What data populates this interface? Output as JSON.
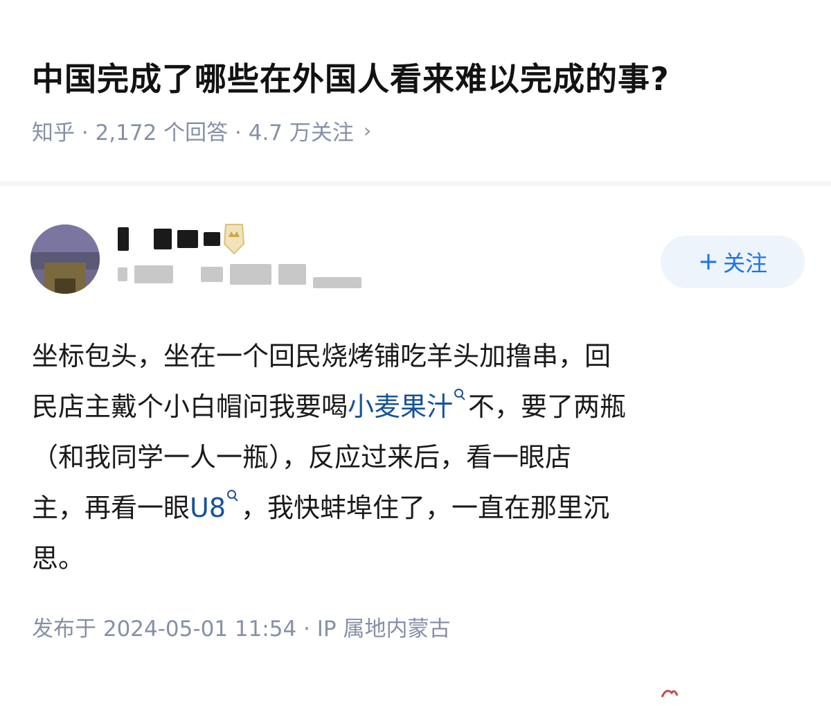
{
  "question": {
    "title": "中国完成了哪些在外国人看来难以完成的事?",
    "meta": "知乎 · 2,172 个回答 · 4.7 万关注",
    "meta_chevron": "›"
  },
  "author": {
    "avatar_icon": "avatar-image",
    "badge_icon": "badge-icon",
    "follow_plus": "+",
    "follow_label": "关注"
  },
  "answer": {
    "lines": [
      {
        "text": "坐标包头，坐在一个回民烧烤铺吃羊头加撸串，回"
      },
      {
        "pre": "民店主戴个小白帽问我要喝",
        "link": "小麦果汁",
        "post": "不，要了两瓶"
      },
      {
        "text": "（和我同学一人一瓶），反应过来后，看一眼店"
      },
      {
        "pre": "主，再看一眼",
        "link": "U8",
        "post": "，我快蚌埠住了，一直在那里沉"
      },
      {
        "text": "思。"
      }
    ]
  },
  "publish": {
    "text": "发布于 2024-05-01 11:54 · IP 属地内蒙古"
  },
  "colors": {
    "accent": "#1772f6",
    "link": "#175199",
    "meta_gray": "#8590a6",
    "follow_bg": "#eef4fb"
  }
}
